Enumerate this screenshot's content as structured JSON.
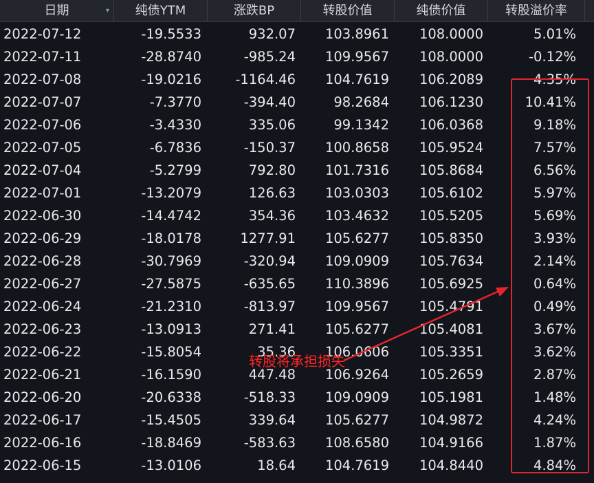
{
  "header": {
    "columns": [
      "日期",
      "纯债YTM",
      "涨跌BP",
      "转股价值",
      "纯债价值",
      "转股溢价率"
    ],
    "sort_icon": "▾"
  },
  "rows": [
    [
      "2022-07-12",
      "-19.5533",
      "932.07",
      "103.8961",
      "108.0000",
      "5.01%"
    ],
    [
      "2022-07-11",
      "-28.8740",
      "-985.24",
      "109.9567",
      "108.0000",
      "-0.12%"
    ],
    [
      "2022-07-08",
      "-19.0216",
      "-1164.46",
      "104.7619",
      "106.2089",
      "4.35%"
    ],
    [
      "2022-07-07",
      "-7.3770",
      "-394.40",
      "98.2684",
      "106.1230",
      "10.41%"
    ],
    [
      "2022-07-06",
      "-3.4330",
      "335.06",
      "99.1342",
      "106.0368",
      "9.18%"
    ],
    [
      "2022-07-05",
      "-6.7836",
      "-150.37",
      "100.8658",
      "105.9524",
      "7.57%"
    ],
    [
      "2022-07-04",
      "-5.2799",
      "792.80",
      "101.7316",
      "105.8684",
      "6.56%"
    ],
    [
      "2022-07-01",
      "-13.2079",
      "126.63",
      "103.0303",
      "105.6102",
      "5.97%"
    ],
    [
      "2022-06-30",
      "-14.4742",
      "354.36",
      "103.4632",
      "105.5205",
      "5.69%"
    ],
    [
      "2022-06-29",
      "-18.0178",
      "1277.91",
      "105.6277",
      "105.8350",
      "3.93%"
    ],
    [
      "2022-06-28",
      "-30.7969",
      "-320.94",
      "109.0909",
      "105.7634",
      "2.14%"
    ],
    [
      "2022-06-27",
      "-27.5875",
      "-635.65",
      "110.3896",
      "105.6925",
      "0.64%"
    ],
    [
      "2022-06-24",
      "-21.2310",
      "-813.97",
      "109.9567",
      "105.4791",
      "0.49%"
    ],
    [
      "2022-06-23",
      "-13.0913",
      "271.41",
      "105.6277",
      "105.4081",
      "3.67%"
    ],
    [
      "2022-06-22",
      "-15.8054",
      "35.36",
      "106.0606",
      "105.3351",
      "3.62%"
    ],
    [
      "2022-06-21",
      "-16.1590",
      "447.48",
      "106.9264",
      "105.2659",
      "2.87%"
    ],
    [
      "2022-06-20",
      "-20.6338",
      "-518.33",
      "109.0909",
      "105.1981",
      "1.48%"
    ],
    [
      "2022-06-17",
      "-15.4505",
      "339.64",
      "105.6277",
      "104.9872",
      "4.24%"
    ],
    [
      "2022-06-16",
      "-18.8469",
      "-583.63",
      "108.6580",
      "104.9166",
      "1.87%"
    ],
    [
      "2022-06-15",
      "-13.0106",
      "18.64",
      "104.7619",
      "104.8440",
      "4.84%"
    ]
  ],
  "annotation": {
    "text": "转股将承担损失",
    "color": "#ff2424"
  }
}
